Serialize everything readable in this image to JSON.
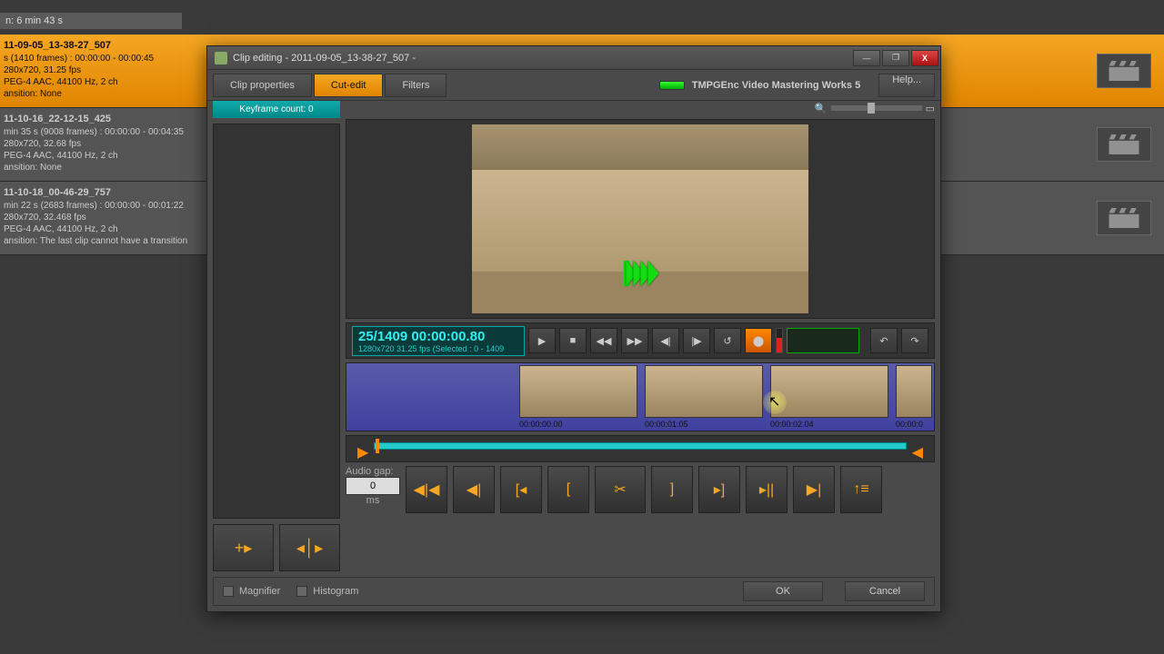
{
  "bg_header": "n: 6 min 43 s",
  "clips": [
    {
      "title": "11-09-05_13-38-27_507",
      "l1": "s (1410 frames) : 00:00:00 - 00:00:45",
      "l2": "280x720, 31.25 fps",
      "l3": "PEG-4 AAC, 44100 Hz, 2 ch",
      "l4": "ansition: None"
    },
    {
      "title": "11-10-16_22-12-15_425",
      "l1": "min 35 s (9008 frames) : 00:00:00 - 00:04:35",
      "l2": "280x720, 32.68 fps",
      "l3": "PEG-4 AAC, 44100 Hz, 2 ch",
      "l4": "ansition: None"
    },
    {
      "title": "11-10-18_00-46-29_757",
      "l1": "min 22 s (2683 frames) : 00:00:00 - 00:01:22",
      "l2": "280x720, 32.468 fps",
      "l3": "PEG-4 AAC, 44100 Hz, 2 ch",
      "l4": "ansition: The last clip cannot have a transition"
    }
  ],
  "dialog": {
    "title": "Clip editing - 2011-09-05_13-38-27_507 -",
    "tabs": {
      "properties": "Clip properties",
      "cut": "Cut-edit",
      "filters": "Filters"
    },
    "brand": "TMPGEnc Video Mastering Works 5",
    "help": "Help...",
    "keyframe": "Keyframe count: 0",
    "time_main": "25/1409  00:00:00.80",
    "time_sub": "1280x720 31.25 fps (Selected : 0 - 1409",
    "thumbs": [
      "00:00:00.00",
      "00:00:01.05",
      "00:00:02.04",
      "00:00:0"
    ],
    "audio_gap_label": "Audio gap:",
    "audio_gap_value": "0",
    "audio_gap_unit": "ms",
    "magnifier": "Magnifier",
    "histogram": "Histogram",
    "ok": "OK",
    "cancel": "Cancel"
  }
}
